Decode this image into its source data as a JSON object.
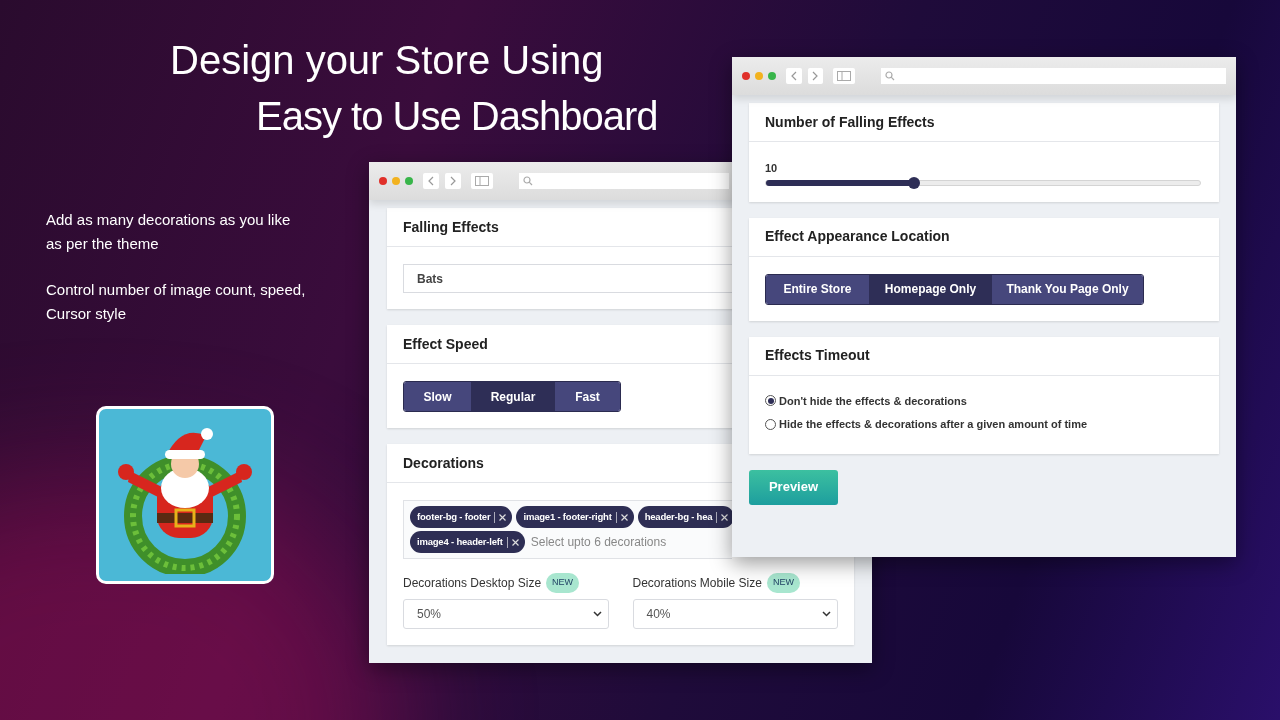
{
  "headline": [
    "Design your Store Using",
    "Easy to Use Dashboard"
  ],
  "features": [
    "Add as many decorations as you like as per the theme",
    "Control number of image count, speed, Cursor style"
  ],
  "back_window": {
    "sections": [
      {
        "kind": "select",
        "title": "Falling Effects",
        "value": "Bats"
      },
      {
        "kind": "segmented",
        "title": "Effect Speed",
        "options": [
          {
            "label": "Slow",
            "selected": false
          },
          {
            "label": "Regular",
            "selected": true
          },
          {
            "label": "Fast",
            "selected": false
          }
        ]
      },
      {
        "kind": "tags",
        "title": "Decorations",
        "tags": [
          "footer-bg - footer",
          "image1 - footer-right",
          "header-bg - hea",
          "image4 - header-left"
        ],
        "placeholder": "Select upto 6 decorations",
        "sizes": [
          {
            "label": "Decorations Desktop Size",
            "badge": "NEW",
            "value": "50%"
          },
          {
            "label": "Decorations Mobile Size",
            "badge": "NEW",
            "value": "40%"
          }
        ]
      }
    ]
  },
  "front_window": {
    "sections": [
      {
        "kind": "slider",
        "title": "Number of Falling Effects",
        "reading": "10",
        "level": 0.34
      },
      {
        "kind": "segmented",
        "title": "Effect Appearance Location",
        "options": [
          {
            "label": "Entire Store",
            "selected": false
          },
          {
            "label": "Homepage Only",
            "selected": true
          },
          {
            "label": "Thank You Page Only",
            "selected": false
          }
        ]
      },
      {
        "kind": "radio",
        "title": "Effects Timeout",
        "options": [
          {
            "label": "Don't hide the effects & decorations",
            "checked": true
          },
          {
            "label": "Hide the effects & decorations after a given amount of time",
            "checked": false
          }
        ]
      }
    ],
    "preview_button": "Preview"
  }
}
